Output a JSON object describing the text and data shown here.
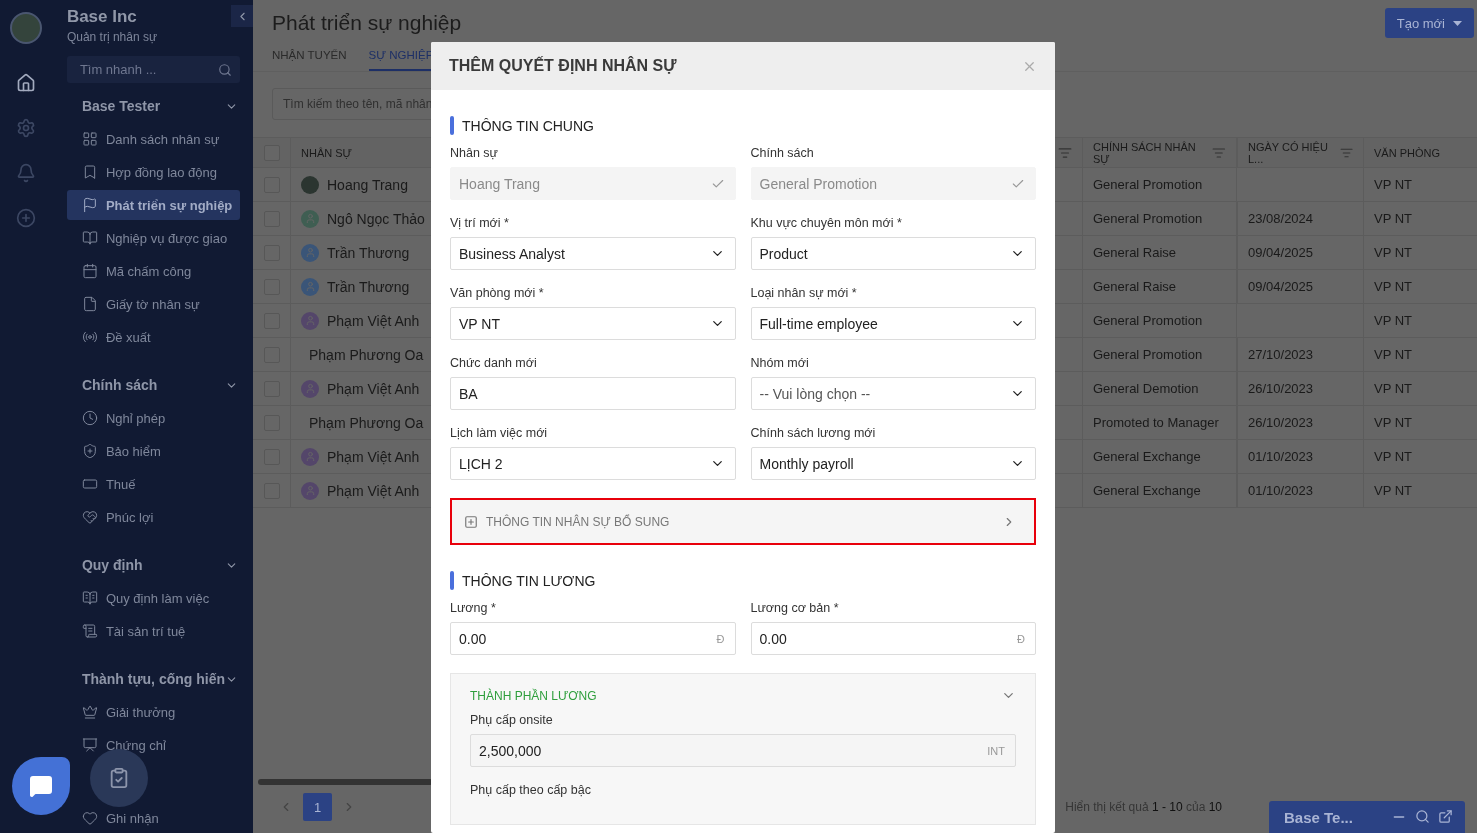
{
  "sidebar": {
    "org_name": "Base Inc",
    "org_subtitle": "Quản trị nhân sự",
    "rail": [
      {
        "selected": true
      },
      {
        "selected": false
      },
      {
        "selected": false
      },
      {
        "selected": false
      }
    ],
    "search": {
      "placeholder": "Tìm nhanh ..."
    },
    "groups": [
      {
        "title": "Base Tester",
        "expanded": true,
        "items": [
          {
            "label": "Danh sách nhân sự",
            "selected": false
          },
          {
            "label": "Hợp đồng lao động",
            "selected": false
          },
          {
            "label": "Phát triển sự nghiệp",
            "selected": true
          },
          {
            "label": "Nghiệp vụ được giao",
            "selected": false
          },
          {
            "label": "Mã chấm công",
            "selected": false
          },
          {
            "label": "Giấy tờ nhân sự",
            "selected": false
          },
          {
            "label": "Đề xuất",
            "selected": false
          }
        ]
      },
      {
        "title": "Chính sách",
        "expanded": true,
        "items": [
          {
            "label": "Nghỉ phép",
            "selected": false
          },
          {
            "label": "Bảo hiểm",
            "selected": false
          },
          {
            "label": "Thuế",
            "selected": false
          },
          {
            "label": "Phúc lợi",
            "selected": false
          }
        ]
      },
      {
        "title": "Quy định",
        "expanded": true,
        "items": [
          {
            "label": "Quy định làm việc",
            "selected": false
          },
          {
            "label": "Tài sản trí tuệ",
            "selected": false
          }
        ]
      },
      {
        "title": "Thành tựu, cống hiến",
        "expanded": true,
        "items": [
          {
            "label": "Giải thưởng",
            "selected": false
          },
          {
            "label": "Chứng chỉ",
            "selected": false
          },
          {
            "label": "Ghi nhận",
            "selected": false
          }
        ]
      }
    ]
  },
  "main": {
    "title": "Phát triển sự nghiệp",
    "create_button": "Tạo mới",
    "tabs": [
      {
        "label": "NHẬN TUYỂN",
        "selected": false
      },
      {
        "label": "SỰ NGHIỆP",
        "selected": true
      }
    ],
    "search": {
      "placeholder": "Tìm kiếm theo tên, mã nhân"
    },
    "table": {
      "header_checked": false,
      "columns": [
        {
          "label": "NHÂN SỰ",
          "filter": false
        },
        {
          "filter": true
        },
        {
          "label": "CHÍNH SÁCH NHÂN SỰ",
          "filter": true
        },
        {
          "label": "NGÀY CÓ HIỆU L...",
          "filter": true
        },
        {
          "label": "VĂN PHÒNG",
          "filter": false
        }
      ],
      "rows": [
        {
          "checked": false,
          "avatar": {
            "kind": "photo"
          },
          "name": "Hoang Trang",
          "policy": "General Promotion",
          "office": "VP NT"
        },
        {
          "checked": false,
          "avatar": {
            "kind": "person",
            "color": "#3f5e52"
          },
          "name": "Ngô Ngọc Thảo",
          "policy": "General Promotion",
          "date": "23/08/2024",
          "office": "VP NT"
        },
        {
          "checked": false,
          "avatar": {
            "kind": "person",
            "color": "#3a5578"
          },
          "name": "Trần Thương",
          "policy": "General Raise",
          "date": "09/04/2025",
          "office": "VP NT"
        },
        {
          "checked": false,
          "avatar": {
            "kind": "person",
            "color": "#3a5578"
          },
          "name": "Trần Thương",
          "policy": "General Raise",
          "date": "09/04/2025",
          "office": "VP NT"
        },
        {
          "checked": false,
          "avatar": {
            "kind": "person",
            "color": "#54466a"
          },
          "name": "Phạm Việt Anh",
          "policy": "General Promotion",
          "office": "VP NT"
        },
        {
          "checked": false,
          "avatar": {
            "kind": "image"
          },
          "name": "Phạm Phương Oa",
          "policy": "General Promotion",
          "date": "27/10/2023",
          "office": "VP NT"
        },
        {
          "checked": false,
          "avatar": {
            "kind": "person",
            "color": "#54466a"
          },
          "name": "Phạm Việt Anh",
          "policy": "General Demotion",
          "date": "26/10/2023",
          "office": "VP NT"
        },
        {
          "checked": false,
          "avatar": {
            "kind": "image"
          },
          "name": "Phạm Phương Oa",
          "policy": "Promoted to Manager",
          "date": "26/10/2023",
          "office": "VP NT"
        },
        {
          "checked": false,
          "avatar": {
            "kind": "person",
            "color": "#54466a"
          },
          "name": "Phạm Việt Anh",
          "policy": "General Exchange",
          "date": "01/10/2023",
          "office": "VP NT"
        },
        {
          "checked": false,
          "avatar": {
            "kind": "person",
            "color": "#54466a"
          },
          "name": "Phạm Việt Anh",
          "policy": "General Exchange",
          "date": "01/10/2023",
          "office": "VP NT"
        }
      ]
    },
    "pagination": {
      "pages": [
        {
          "label": "1",
          "selected": true
        }
      ]
    },
    "summary": "Hiển thị kết quả **1 - 10** của **10**"
  },
  "chat_dock": {
    "title": "Base Te..."
  },
  "modal": {
    "title": "THÊM QUYẾT ĐỊNH NHÂN SỰ",
    "sections": [
      {
        "kind": "section",
        "title": "THÔNG TIN CHUNG",
        "fields": [
          {
            "label": "Nhân sự",
            "kind": "readonly",
            "value": "Hoang Trang"
          },
          {
            "label": "Chính sách",
            "kind": "readonly",
            "value": "General Promotion"
          },
          {
            "label": "Vị trí mới *",
            "kind": "select",
            "value": "Business Analyst"
          },
          {
            "label": "Khu vực chuyên môn mới *",
            "kind": "select",
            "value": "Product"
          },
          {
            "label": "Văn phòng mới *",
            "kind": "select",
            "value": "VP NT"
          },
          {
            "label": "Loại nhân sự mới *",
            "kind": "select",
            "value": "Full-time employee"
          },
          {
            "label": "Chức danh mới",
            "kind": "text",
            "value": "BA"
          },
          {
            "label": "Nhóm mới",
            "kind": "select",
            "placeholder": "-- Vui lòng chọn --"
          },
          {
            "label": "Lịch làm việc mới",
            "kind": "select",
            "value": "LỊCH 2"
          },
          {
            "label": "Chính sách lương mới",
            "kind": "select",
            "value": "Monthly payroll"
          }
        ]
      },
      {
        "kind": "collapsible",
        "title": "THÔNG TIN NHÂN SỰ BỔ SUNG",
        "expanded": false,
        "highlighted": true
      },
      {
        "kind": "section",
        "title": "THÔNG TIN LƯƠNG",
        "fields": [
          {
            "label": "Lương *",
            "kind": "amount",
            "value": "0.00",
            "suffix": "Đ"
          },
          {
            "label": "Lương cơ bản *",
            "kind": "amount",
            "value": "0.00",
            "suffix": "Đ"
          }
        ],
        "group": {
          "title": "THÀNH PHẦN LƯƠNG",
          "expanded": true,
          "fields": [
            {
              "label": "Phụ cấp onsite",
              "kind": "amount",
              "value": "2,500,000",
              "suffix": "INT"
            },
            {
              "label": "Phụ cấp theo cấp bậc"
            }
          ]
        }
      }
    ]
  }
}
